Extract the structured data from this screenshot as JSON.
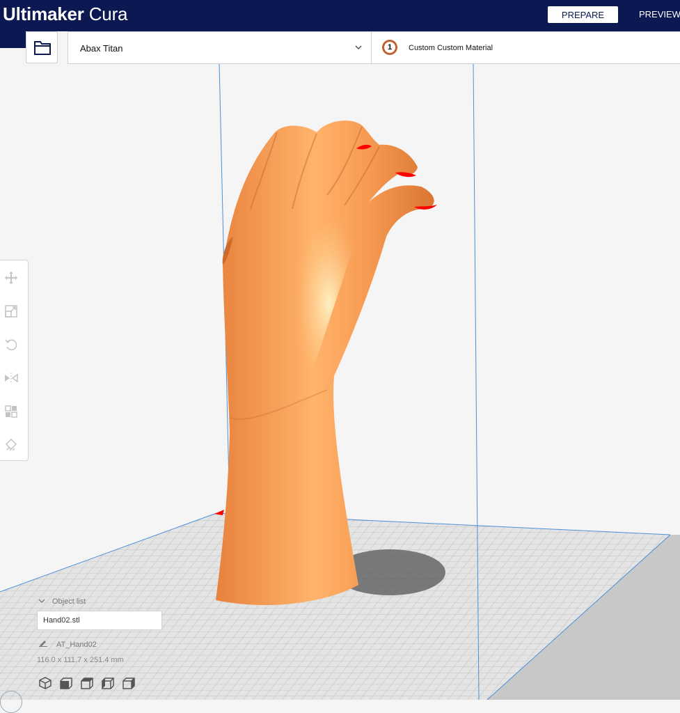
{
  "app": {
    "brand": "Ultimaker",
    "product": "Cura"
  },
  "stages": {
    "prepare": "PREPARE",
    "preview": "PREVIEW"
  },
  "open_file": {
    "icon": "folder-icon"
  },
  "printer": {
    "name": "Abax Titan",
    "icon": "chevron-down-icon"
  },
  "extruder": {
    "number": "1",
    "material": "Custom Custom Material",
    "color": "#c0622b"
  },
  "tools": [
    {
      "name": "move-tool",
      "icon": "move-icon"
    },
    {
      "name": "scale-tool",
      "icon": "scale-icon"
    },
    {
      "name": "rotate-tool",
      "icon": "rotate-icon"
    },
    {
      "name": "mirror-tool",
      "icon": "mirror-icon"
    },
    {
      "name": "per-model-settings-tool",
      "icon": "per-model-settings-icon"
    },
    {
      "name": "support-blocker-tool",
      "icon": "support-blocker-icon"
    }
  ],
  "object_list": {
    "label": "Object list",
    "items": [
      "Hand02.stl"
    ]
  },
  "job": {
    "name": "AT_Hand02",
    "dimensions": "116.0 x 111.7 x 251.4 mm"
  },
  "camera_views": [
    "3d-view-icon",
    "front-view-icon",
    "top-view-icon",
    "left-view-icon",
    "right-view-icon"
  ],
  "colors": {
    "header": "#0b1851",
    "model": "#f7a15a",
    "overhang": "#ff0000",
    "build_volume": "#4a90d9"
  }
}
